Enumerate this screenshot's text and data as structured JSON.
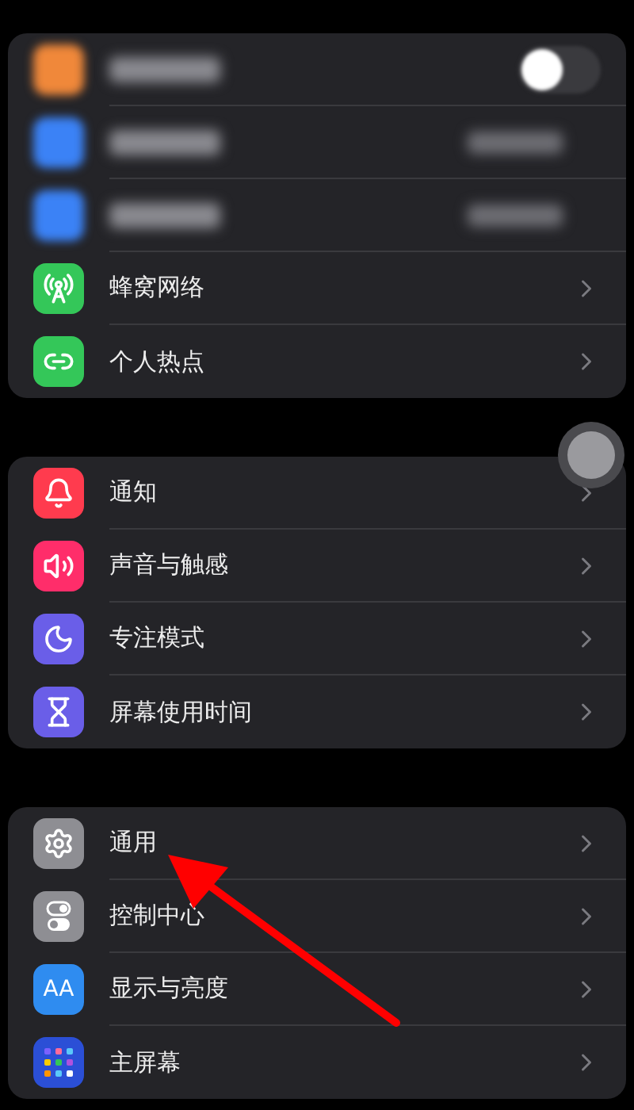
{
  "sections": [
    {
      "rows": [
        {
          "kind": "toggle",
          "color": "#f0883a",
          "on": false
        },
        {
          "kind": "value",
          "color": "#3b82f6"
        },
        {
          "kind": "value",
          "color": "#3b82f6"
        },
        {
          "kind": "link",
          "color": "#34c759",
          "label": "蜂窝网络"
        },
        {
          "kind": "link",
          "color": "#34c759",
          "label": "个人热点"
        }
      ]
    },
    {
      "rows": [
        {
          "kind": "link",
          "color": "#ff3b4e",
          "label": "通知"
        },
        {
          "kind": "link",
          "color": "#ff2d6a",
          "label": "声音与触感"
        },
        {
          "kind": "link",
          "color": "#6a5ee8",
          "label": "专注模式"
        },
        {
          "kind": "link",
          "color": "#6a5ee8",
          "label": "屏幕使用时间"
        }
      ]
    },
    {
      "rows": [
        {
          "kind": "link",
          "color": "#8e8e93",
          "label": "通用"
        },
        {
          "kind": "link",
          "color": "#8e8e93",
          "label": "控制中心"
        },
        {
          "kind": "link",
          "color": "#2f8cf0",
          "label": "显示与亮度",
          "icon_text": "AA"
        },
        {
          "kind": "link",
          "color": "#2b4fd6",
          "label": "主屏幕"
        }
      ]
    }
  ]
}
